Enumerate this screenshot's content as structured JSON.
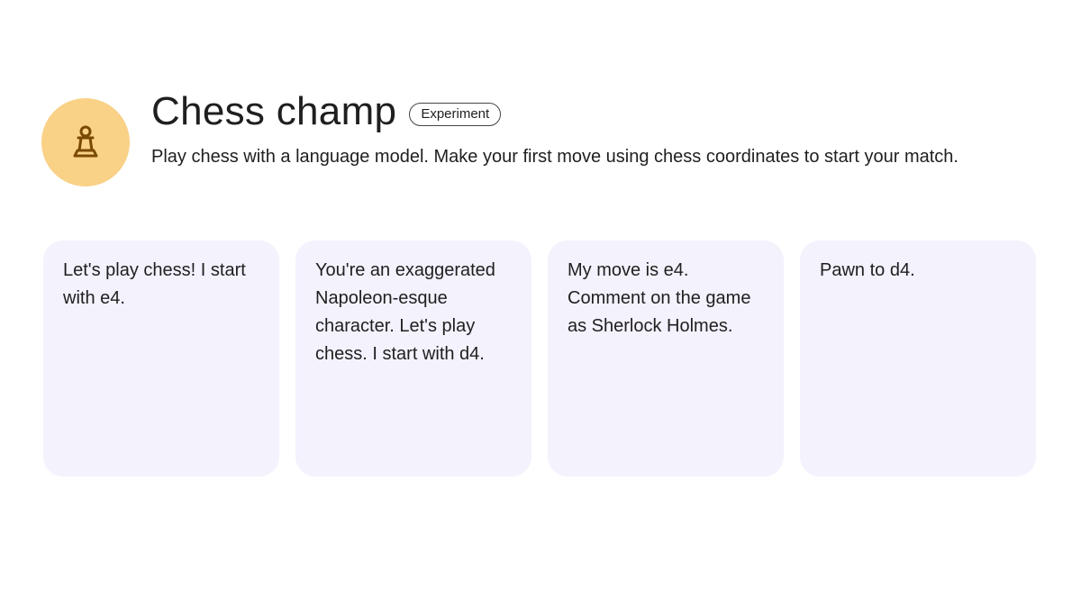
{
  "header": {
    "icon": "chess-pawn-icon",
    "title": "Chess champ",
    "badge": "Experiment",
    "description": "Play chess with a language model. Make your first move using chess coordinates to start your match."
  },
  "prompts": [
    {
      "text": "Let's play chess! I start with e4."
    },
    {
      "text": "You're an exaggerated Napoleon-esque character. Let's play chess. I start with d4."
    },
    {
      "text": "My move is e4. Comment on the game as Sherlock Holmes."
    },
    {
      "text": "Pawn to d4."
    }
  ],
  "colors": {
    "avatar_bg": "#f9d187",
    "icon_stroke": "#7a4a00",
    "card_bg": "#f3f2fd"
  }
}
